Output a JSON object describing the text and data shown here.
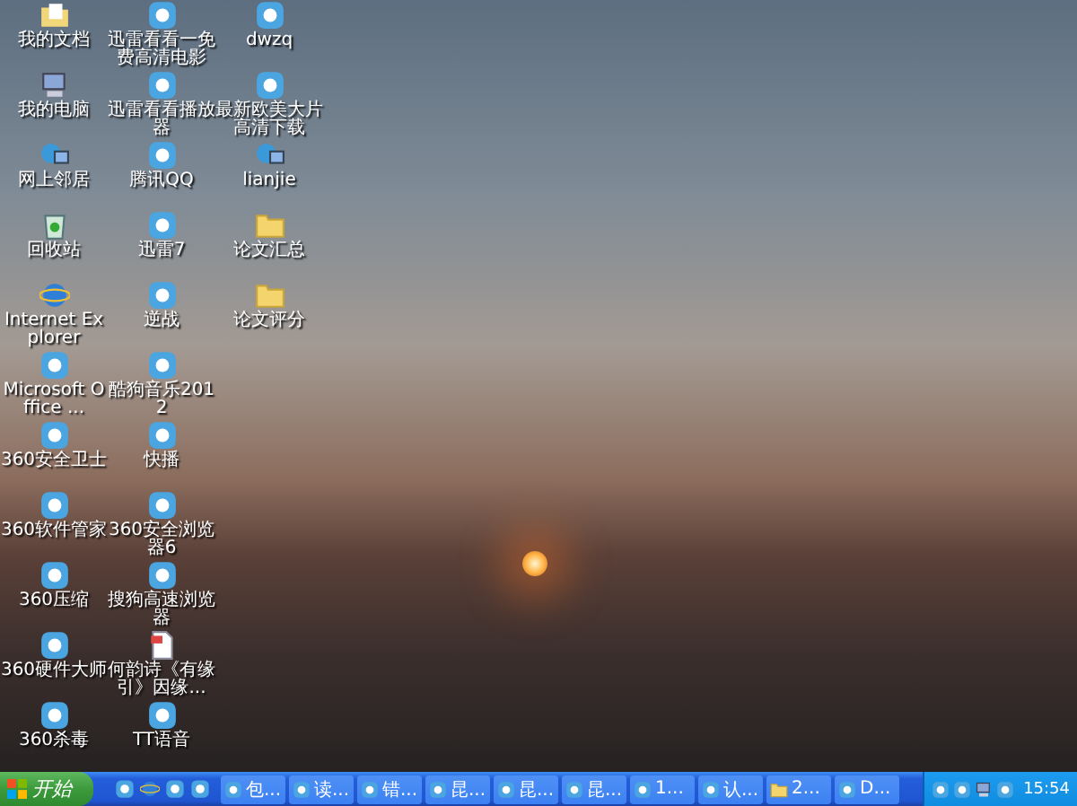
{
  "desktop_icons": [
    {
      "label": "我的文档",
      "kind": "documents"
    },
    {
      "label": "我的电脑",
      "kind": "computer"
    },
    {
      "label": "网上邻居",
      "kind": "network"
    },
    {
      "label": "回收站",
      "kind": "trash"
    },
    {
      "label": "Internet Explorer",
      "kind": "browser"
    },
    {
      "label": "Microsoft Office ...",
      "kind": "app"
    },
    {
      "label": "360安全卫士",
      "kind": "app"
    },
    {
      "label": "360软件管家",
      "kind": "app"
    },
    {
      "label": "360压缩",
      "kind": "app"
    },
    {
      "label": "360硬件大师",
      "kind": "app"
    },
    {
      "label": "360杀毒",
      "kind": "app"
    },
    {
      "label": "迅雷看看一免费高清电影",
      "kind": "app"
    },
    {
      "label": "迅雷看看播放器",
      "kind": "app"
    },
    {
      "label": "腾讯QQ",
      "kind": "app"
    },
    {
      "label": "迅雷7",
      "kind": "app"
    },
    {
      "label": "逆战",
      "kind": "app"
    },
    {
      "label": "酷狗音乐2012",
      "kind": "app"
    },
    {
      "label": "快播",
      "kind": "app"
    },
    {
      "label": "360安全浏览器6",
      "kind": "app"
    },
    {
      "label": "搜狗高速浏览器",
      "kind": "app"
    },
    {
      "label": "何韵诗《有缘引》因缘...",
      "kind": "document"
    },
    {
      "label": "TT语音",
      "kind": "app"
    },
    {
      "label": "dwzq",
      "kind": "app"
    },
    {
      "label": "最新欧美大片高清下载",
      "kind": "app"
    },
    {
      "label": "lianjie",
      "kind": "network"
    },
    {
      "label": "论文汇总",
      "kind": "folder"
    },
    {
      "label": "论文评分",
      "kind": "folder"
    }
  ],
  "taskbar": {
    "start_label": "开始",
    "tasks": [
      {
        "label": "包...",
        "kind": "app"
      },
      {
        "label": "读...",
        "kind": "app"
      },
      {
        "label": "错...",
        "kind": "app"
      },
      {
        "label": "昆...",
        "kind": "app"
      },
      {
        "label": "昆...",
        "kind": "app"
      },
      {
        "label": "昆...",
        "kind": "app"
      },
      {
        "label": "1...",
        "kind": "app"
      },
      {
        "label": "认...",
        "kind": "app"
      },
      {
        "label": "2...",
        "kind": "folder"
      },
      {
        "label": "D...",
        "kind": "app"
      }
    ],
    "clock": "15:54"
  }
}
